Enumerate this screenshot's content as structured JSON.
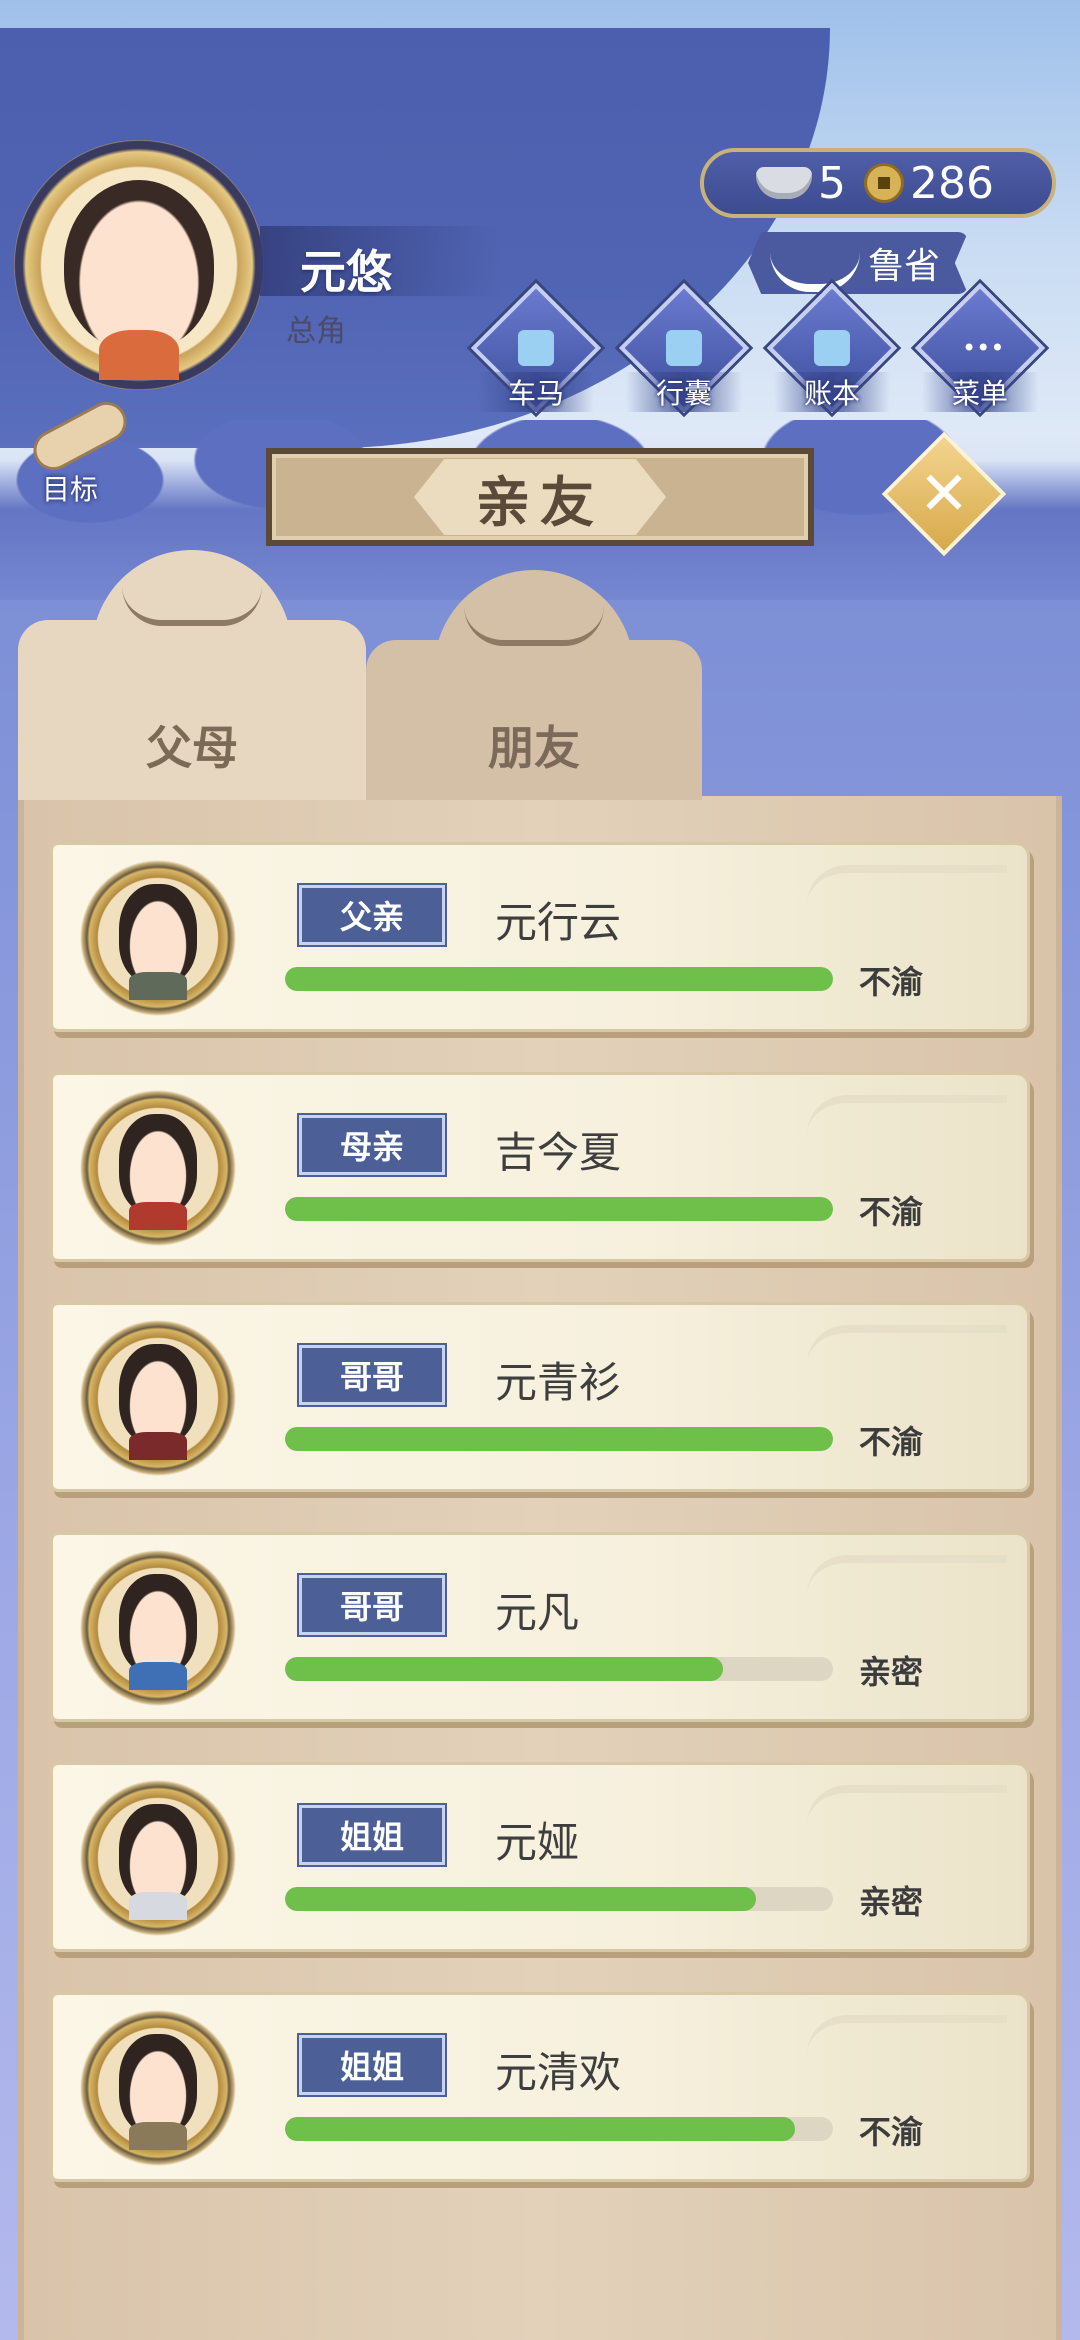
{
  "player": {
    "name": "元悠",
    "role": "总角"
  },
  "currency": {
    "silver": "5",
    "coins": "286"
  },
  "location": "鲁省",
  "actions": [
    {
      "label": "车马",
      "icon": "carriage-icon"
    },
    {
      "label": "行囊",
      "icon": "bag-icon"
    },
    {
      "label": "账本",
      "icon": "ledger-icon"
    },
    {
      "label": "菜单",
      "icon": "menu-icon"
    }
  ],
  "goal_label": "目标",
  "title": "亲友",
  "tabs": [
    {
      "label": "父母",
      "active": true
    },
    {
      "label": "朋友",
      "active": false
    }
  ],
  "relatives": [
    {
      "relation": "父亲",
      "name": "元行云",
      "mood": "不渝",
      "affinity": 1.0
    },
    {
      "relation": "母亲",
      "name": "吉今夏",
      "mood": "不渝",
      "affinity": 1.0
    },
    {
      "relation": "哥哥",
      "name": "元青衫",
      "mood": "不渝",
      "affinity": 1.0
    },
    {
      "relation": "哥哥",
      "name": "元凡",
      "mood": "亲密",
      "affinity": 0.8
    },
    {
      "relation": "姐姐",
      "name": "元娅",
      "mood": "亲密",
      "affinity": 0.86
    },
    {
      "relation": "姐姐",
      "name": "元清欢",
      "mood": "不渝",
      "affinity": 0.93
    }
  ],
  "colors": {
    "bar_fill": "#6fbf4b",
    "tag_bg": "#4c5f96",
    "banner": "#4c5fae"
  }
}
